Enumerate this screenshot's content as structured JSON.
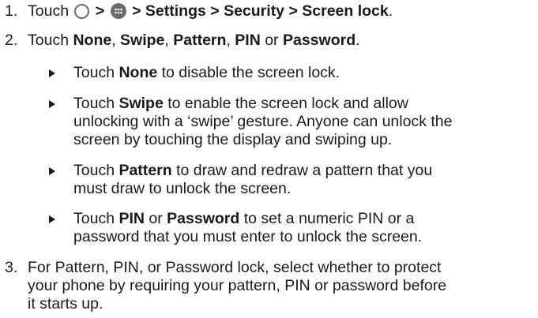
{
  "steps": [
    {
      "number": "1.",
      "parts": {
        "p0": "Touch",
        "sep1": ">",
        "sep2": "> Settings > Security > Screen lock",
        "end": "."
      }
    },
    {
      "number": "2.",
      "parts": {
        "p0": "Touch ",
        "none": "None",
        "c1": ", ",
        "swipe": "Swipe",
        "c2": ", ",
        "pattern": "Pattern",
        "c3": ", ",
        "pin": "PIN",
        "c4": " or ",
        "password": "Password",
        "end": "."
      }
    },
    {
      "number": "3.",
      "lines": [
        "For Pattern, PIN, or Password lock, select whether to protect",
        "your phone by requiring your pattern, PIN or password before",
        "it starts up."
      ]
    }
  ],
  "bullets": [
    {
      "pre": "Touch ",
      "bold": "None",
      "lines": [
        " to disable the screen lock."
      ]
    },
    {
      "pre": "Touch ",
      "bold": "Swipe",
      "lines": [
        " to enable the screen lock and allow",
        "unlocking with a ‘swipe’ gesture. Anyone can unlock the",
        "screen by touching the display and swiping up."
      ]
    },
    {
      "pre": "Touch ",
      "bold": "Pattern",
      "lines": [
        " to draw and redraw a pattern that you",
        "must draw to unlock the screen."
      ]
    },
    {
      "pre": "Touch ",
      "bold": "PIN",
      "mid": " or ",
      "bold2": "Password",
      "lines": [
        " to set a numeric PIN or a",
        "password that you must enter to unlock the screen."
      ]
    }
  ],
  "icons": {
    "home": "home-circle-icon",
    "apps": "apps-grid-icon"
  }
}
